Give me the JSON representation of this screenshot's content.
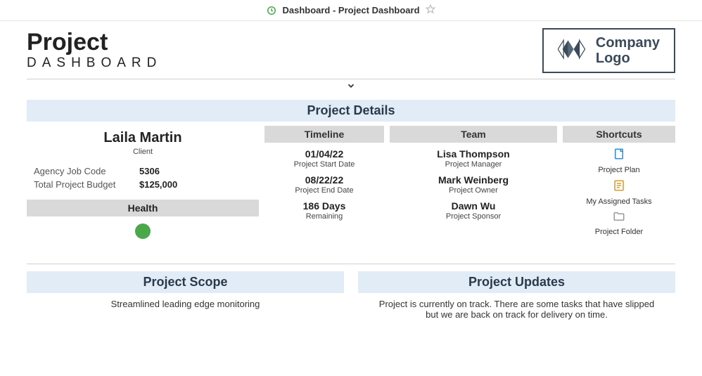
{
  "topbar": {
    "title": "Dashboard - Project Dashboard"
  },
  "header": {
    "title": "Project",
    "subtitle": "DASHBOARD",
    "logo_line1": "Company",
    "logo_line2": "Logo"
  },
  "section_details": "Project Details",
  "client": {
    "name": "Laila Martin",
    "role": "Client",
    "job_code_label": "Agency Job Code",
    "job_code": "5306",
    "budget_label": "Total Project Budget",
    "budget": "$125,000",
    "health_label": "Health",
    "health_color": "#4aa84a"
  },
  "timeline": {
    "header": "Timeline",
    "start_date": "01/04/22",
    "start_label": "Project Start Date",
    "end_date": "08/22/22",
    "end_label": "Project End Date",
    "remaining_days": "186 Days",
    "remaining_label": "Remaining"
  },
  "team": {
    "header": "Team",
    "members": [
      {
        "name": "Lisa Thompson",
        "role": "Project Manager"
      },
      {
        "name": "Mark Weinberg",
        "role": "Project Owner"
      },
      {
        "name": "Dawn Wu",
        "role": "Project Sponsor"
      }
    ]
  },
  "shortcuts": {
    "header": "Shortcuts",
    "items": [
      {
        "label": "Project Plan"
      },
      {
        "label": "My Assigned Tasks"
      },
      {
        "label": "Project Folder"
      }
    ]
  },
  "scope": {
    "header": "Project Scope",
    "body": "Streamlined leading edge monitoring"
  },
  "updates": {
    "header": "Project Updates",
    "body": "Project is currently on track. There are some tasks that have slipped but we are back on track for delivery on time."
  }
}
